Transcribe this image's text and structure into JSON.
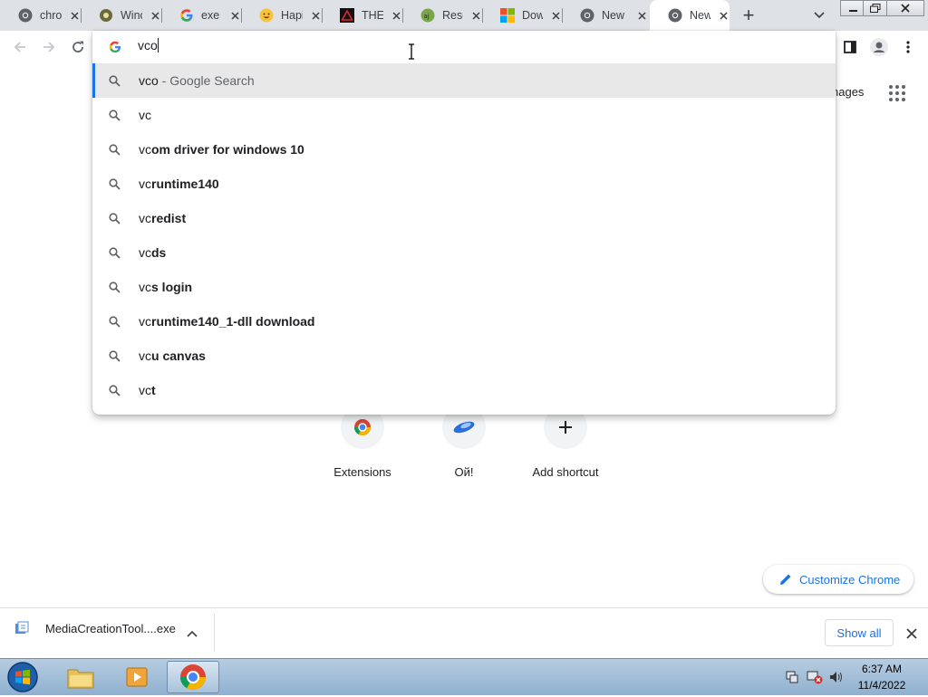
{
  "tabs": [
    {
      "title": "chro",
      "icon": "chrome-icon"
    },
    {
      "title": "Winc",
      "icon": "gear-icon"
    },
    {
      "title": "exe d",
      "icon": "google-icon"
    },
    {
      "title": "Hapi",
      "icon": "emoji-icon"
    },
    {
      "title": "THE",
      "icon": "warning-logo-icon"
    },
    {
      "title": "Resc",
      "icon": "green-site-icon"
    },
    {
      "title": "Dow",
      "icon": "microsoft-icon"
    },
    {
      "title": "New",
      "icon": "chrome-icon"
    },
    {
      "title": "New",
      "icon": "chrome-icon"
    }
  ],
  "omnibox": {
    "query": "vco",
    "suggestions": [
      {
        "typed": "vco",
        "completion": "",
        "suffix": " - Google Search",
        "selected": true
      },
      {
        "typed": "vc",
        "completion": "",
        "suffix": ""
      },
      {
        "typed": "vc",
        "completion": "om driver for windows 10",
        "suffix": ""
      },
      {
        "typed": "vc",
        "completion": "runtime140",
        "suffix": ""
      },
      {
        "typed": "vc",
        "completion": "redist",
        "suffix": ""
      },
      {
        "typed": "vc",
        "completion": "ds",
        "suffix": ""
      },
      {
        "typed": "vc",
        "completion": "s login",
        "suffix": ""
      },
      {
        "typed": "vc",
        "completion": "runtime140_1-dll download",
        "suffix": ""
      },
      {
        "typed": "vc",
        "completion": "u canvas",
        "suffix": ""
      },
      {
        "typed": "vc",
        "completion": "t",
        "suffix": ""
      }
    ]
  },
  "page": {
    "images_link": "nages",
    "shortcuts": [
      {
        "label": "Extensions",
        "icon": "chrome-web-store-icon"
      },
      {
        "label": "Ой!",
        "icon": "blue-swoosh-icon"
      },
      {
        "label": "Add shortcut",
        "icon": "plus-icon"
      }
    ],
    "customize_label": "Customize Chrome"
  },
  "downloads": {
    "file_name": "MediaCreationTool....exe",
    "show_all": "Show all"
  },
  "taskbar": {
    "time": "6:37 AM",
    "date": "11/4/2022",
    "apps": [
      "file-explorer-icon",
      "media-player-icon",
      "chrome-icon"
    ]
  },
  "colors": {
    "accent": "#1a73e8",
    "tabstrip": "#dee1e6",
    "selected_row": "#e8e8e9"
  }
}
